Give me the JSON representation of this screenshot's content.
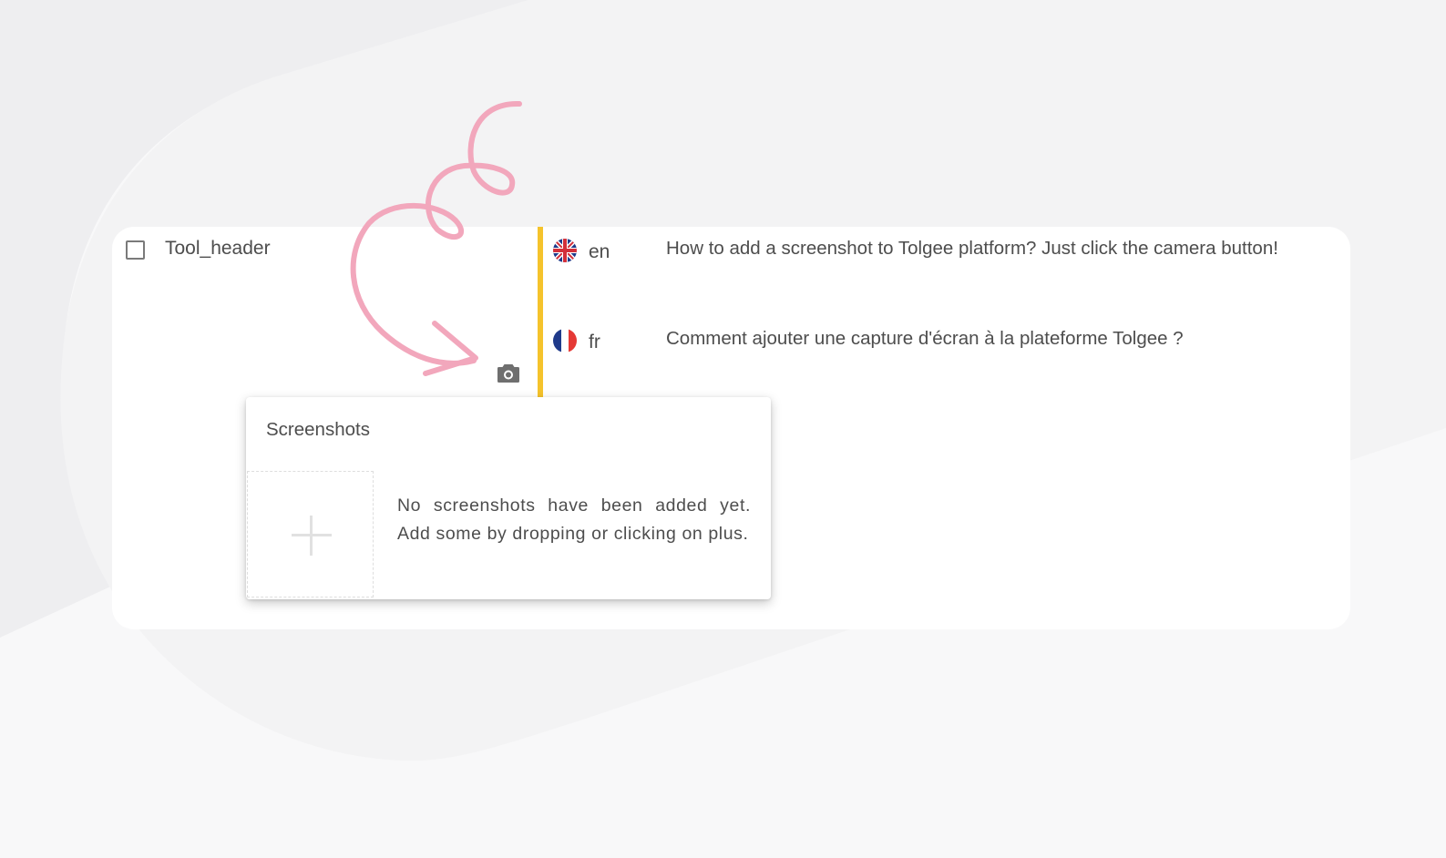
{
  "colors": {
    "accent_state": "#f5c32c",
    "doodle": "#f2a7bc",
    "background": "#f7f7f8",
    "card": "#ffffff"
  },
  "key_row": {
    "checkbox_checked": false,
    "key_name": "Tool_header"
  },
  "translations": [
    {
      "flag_icon": "uk-flag-icon",
      "lang": "en",
      "text": "How to add a screenshot to Tolgee platform? Just click the camera button!"
    },
    {
      "flag_icon": "france-flag-icon",
      "lang": "fr",
      "text": "Comment ajouter une capture d'écran à la plateforme Tolgee ?"
    }
  ],
  "camera_button": {
    "icon": "camera-icon"
  },
  "screenshots_popover": {
    "title": "Screenshots",
    "add_icon": "plus-icon",
    "empty_message": "No screenshots have been added yet. Add some by dropping or clicking on plus."
  }
}
